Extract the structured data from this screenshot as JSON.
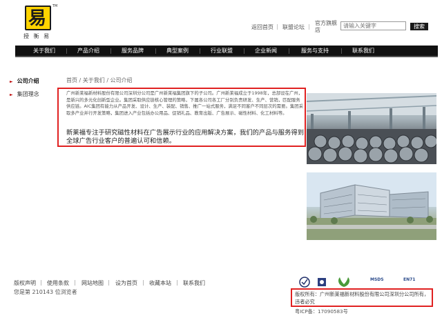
{
  "logo": {
    "glyph": "易",
    "tm": "TM",
    "text": "授 衡 易"
  },
  "header": {
    "links": [
      "返回首页",
      "联盟论坛"
    ],
    "flagship": "官方旗舰店",
    "search_placeholder": "请输入关键字",
    "search_button": "搜索"
  },
  "nav": [
    "关于我们",
    "产品介绍",
    "服务品牌",
    "典型案例",
    "行业联盟",
    "企业新闻",
    "服务与支持",
    "联系我们"
  ],
  "sidebar": [
    {
      "label": "公司介绍",
      "active": true
    },
    {
      "label": "集团理念",
      "active": false
    }
  ],
  "breadcrumb": "首页 / 关于我们 / 公司介绍",
  "intro": {
    "small": "广州新莱福新材料股份有限公司深圳分公司是广州新莱福集团旗下的子公司。广州新莱福成立于1998年，总部设在广州，是新兴的多元化创新型企业。集团采取供应链核心管理的策略，下属各公司各工厂分别负责研发、生产、营销，匹配服务供应链。AIC集团有能力从产品开发、设计、生产、装配、销售、推广一站式服务，满足不同客户不同层次的需要。集团采取多产业并行开发策略，集团进入产业包括办公用品、促销礼品、教育出版、广告展示、磁性材料、化工材料等。",
    "big": "新莱福专注于研究磁性材料在广告展示行业的应用解决方案，我们的产品与服务得到全球广告行业客户的普遍认可和信赖。"
  },
  "footer": {
    "links": [
      "版权声明",
      "使用条款",
      "网站地图",
      "设为首页",
      "收藏本站",
      "联系我们"
    ],
    "visits": "您是第 210143 位浏览者",
    "certs": [
      "MSDS",
      "EN71"
    ],
    "copyright": "版权所有：广州新莱福新材料股份有限公司深圳分公司所有，违者必究",
    "icp": "粤ICP备：17090583号"
  }
}
